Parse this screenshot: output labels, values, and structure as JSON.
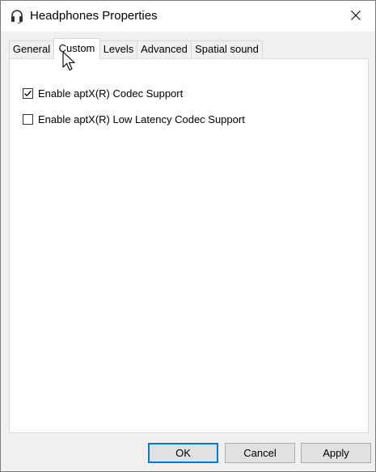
{
  "window": {
    "title": "Headphones Properties",
    "icon": "headphones-icon",
    "close_icon": "close-icon"
  },
  "tabs": [
    {
      "label": "General",
      "active": false
    },
    {
      "label": "Custom",
      "active": true
    },
    {
      "label": "Levels",
      "active": false
    },
    {
      "label": "Advanced",
      "active": false
    },
    {
      "label": "Spatial sound",
      "active": false
    }
  ],
  "options": [
    {
      "label": "Enable aptX(R) Codec Support",
      "checked": true
    },
    {
      "label": "Enable aptX(R) Low Latency Codec Support",
      "checked": false
    }
  ],
  "buttons": {
    "ok": "OK",
    "cancel": "Cancel",
    "apply": "Apply"
  },
  "colors": {
    "accent": "#0078d7",
    "panel_bg": "#ffffff",
    "window_bg": "#f0f0f0"
  }
}
